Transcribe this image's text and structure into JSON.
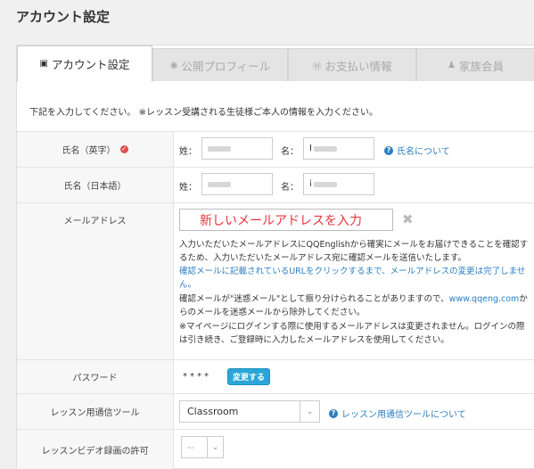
{
  "page_title": "アカウント設定",
  "tabs": [
    {
      "label": "アカウント設定",
      "icon": "id-card-icon",
      "active": true
    },
    {
      "label": "公開プロフィール",
      "icon": "globe-icon",
      "active": false
    },
    {
      "label": "お支払い情報",
      "icon": "coin-icon",
      "active": false
    },
    {
      "label": "家族会員",
      "icon": "users-icon",
      "active": false
    }
  ],
  "intro": "下記を入力してください。 ※レッスン受講される生徒様ご本人の情報を入力ください。",
  "name_en": {
    "label": "氏名（英字）",
    "last_label": "姓：",
    "first_label": "名：",
    "first_value": "I",
    "help": "氏名について"
  },
  "name_ja": {
    "label": "氏名（日本語）",
    "last_label": "姓：",
    "first_label": "名：",
    "first_value": "i"
  },
  "email": {
    "label": "メールアドレス",
    "placeholder": "新しいメールアドレスを入力",
    "note1": "入力いただいたメールアドレスにQQEnglishから確実にメールをお届けできることを確認するため、入力いただいたメールアドレス宛に確認メールを送信いたします。",
    "note2": "確認メールに記載されているURLをクリックするまで、メールアドレスの変更は完了しません。",
    "note3_a": "確認メールが\"迷惑メール\"として振り分けられることがありますので、",
    "note3_link": "www.qqeng.com",
    "note3_b": "からのメールを迷惑メールから除外してください。",
    "note4": "※マイページにログインする際に使用するメールアドレスは変更されません。ログインの際は引き続き、ご登録時に入力したメールアドレスを使用してください。"
  },
  "password": {
    "label": "パスワード",
    "masked": "****",
    "change_button": "変更する"
  },
  "lesson_tool": {
    "label": "レッスン用通信ツール",
    "selected": "Classroom",
    "help": "レッスン用通信ツールについて"
  },
  "video_recording": {
    "label": "レッスンビデオ録画の許可",
    "selected": "--"
  },
  "colors": {
    "link": "#2b7fc3",
    "button": "#2aa6d9",
    "placeholder_red": "#e8333a",
    "verified_red": "#d9534f"
  }
}
